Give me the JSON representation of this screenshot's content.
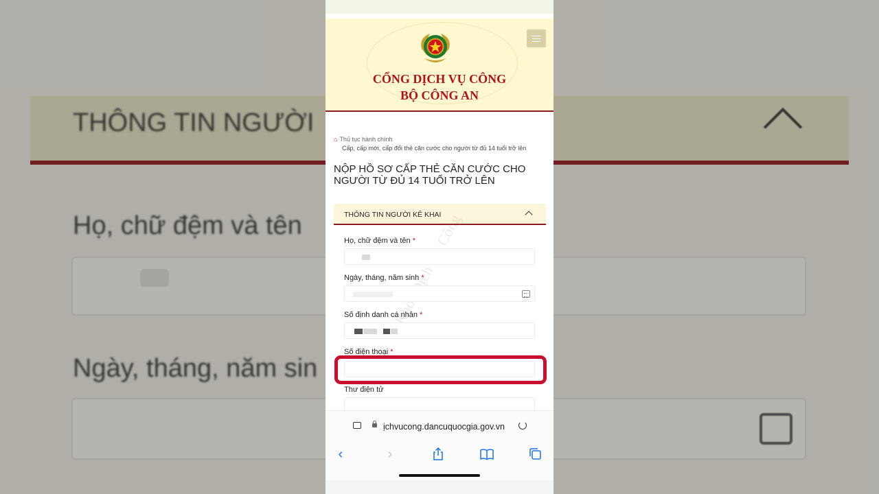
{
  "background": {
    "title_text": "THÔNG TIN NGƯỜI",
    "field1_text": "Họ, chữ đệm và tên",
    "field2_text": "Ngày, tháng, năm sin"
  },
  "header": {
    "title_line1": "CỔNG DỊCH VỤ CÔNG",
    "title_line2": "BỘ CÔNG AN"
  },
  "breadcrumb": {
    "item1": "Thủ tục hành chính",
    "item2": "Cấp, cấp mới, cấp đổi thẻ căn cước cho người từ đủ 14 tuổi trở lên"
  },
  "page_title": "NỘP HỒ SƠ CẤP THẺ CĂN CƯỚC CHO NGƯỜI TỪ ĐỦ 14 TUỔI TRỞ LÊN",
  "section": {
    "title": "THÔNG TIN NGƯỜI KÊ KHAI"
  },
  "form": {
    "full_name_label": "Họ, chữ đệm và tên",
    "dob_label": "Ngày, tháng, năm sinh",
    "id_label": "Số định danh cá nhân",
    "phone_label": "Số điện thoại",
    "email_label": "Thư điện tử",
    "required_mark": "*"
  },
  "watermark": "Khởi Dịch Vụ Công",
  "browser": {
    "url": "ịchvucong.dancuquocgia.gov.vn"
  },
  "colors": {
    "brand_red": "#8c1a22",
    "highlight_red": "#c8102e",
    "header_bg": "#fdf8cf",
    "ios_blue": "#1a73e8"
  }
}
